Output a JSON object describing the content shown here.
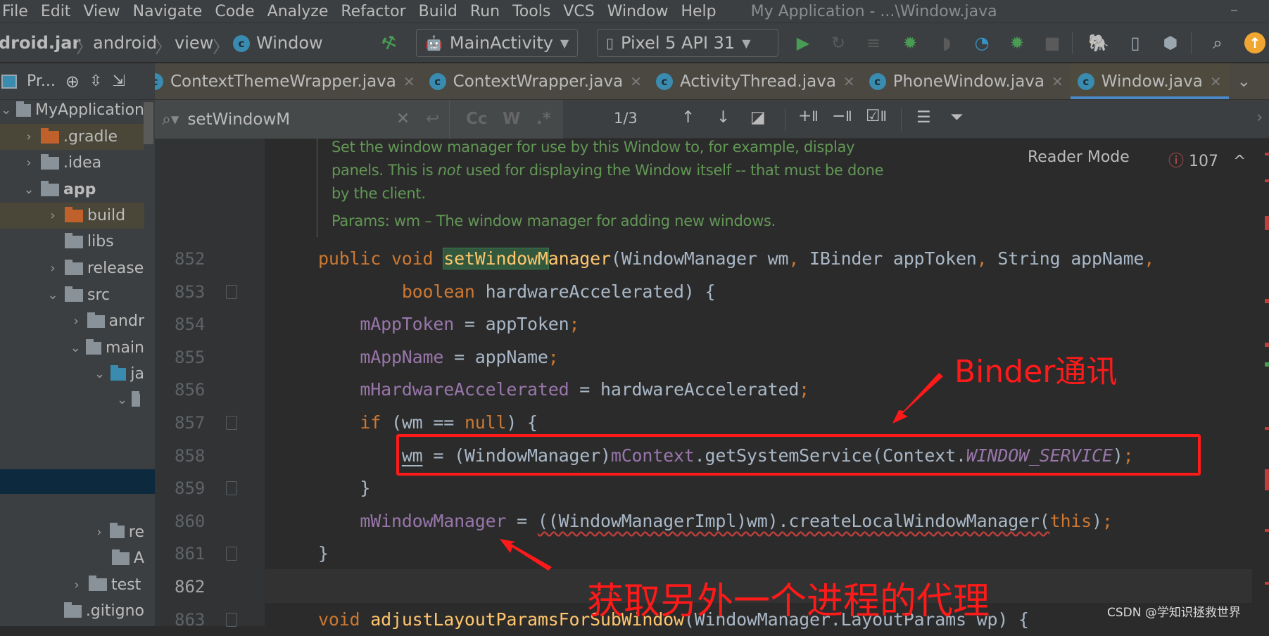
{
  "menu": {
    "items": [
      "File",
      "Edit",
      "View",
      "Navigate",
      "Code",
      "Analyze",
      "Refactor",
      "Build",
      "Run",
      "Tools",
      "VCS",
      "Window",
      "Help"
    ],
    "window_title": "My Application - ...\\Window.java"
  },
  "toolbar": {
    "breadcrumb": [
      "droid.jar",
      "android",
      "view",
      "Window"
    ],
    "run_config": "MainActivity",
    "device": "Pixel 5 API 31",
    "icons": [
      "hammer-icon",
      "run-icon",
      "apply-changes-icon",
      "apply-code-changes-icon",
      "debug-icon",
      "profile-icon",
      "profiler-icon",
      "attach-debugger-icon",
      "stop-icon",
      "gradle-sync-icon",
      "device-manager-icon",
      "sdk-manager-icon",
      "search-icon",
      "update-icon"
    ],
    "accent_green": "#499c54",
    "update_color": "#f0a732"
  },
  "project_panel": {
    "title": "Pr...",
    "tree": [
      {
        "label": "MyApplication",
        "depth": 0,
        "chev": "open",
        "icon": "module"
      },
      {
        "label": ".gradle",
        "depth": 1,
        "chev": "closed",
        "icon": "folder-excluded",
        "highlight": true
      },
      {
        "label": ".idea",
        "depth": 1,
        "chev": "closed",
        "icon": "folder"
      },
      {
        "label": "app",
        "depth": 1,
        "chev": "open",
        "icon": "module",
        "bold": true
      },
      {
        "label": "build",
        "depth": 2,
        "chev": "closed",
        "icon": "folder-excluded",
        "highlight": true
      },
      {
        "label": "libs",
        "depth": 2,
        "chev": "",
        "icon": "folder"
      },
      {
        "label": "release",
        "depth": 2,
        "chev": "closed",
        "icon": "folder"
      },
      {
        "label": "src",
        "depth": 2,
        "chev": "open",
        "icon": "folder"
      },
      {
        "label": "andr",
        "depth": 3,
        "chev": "closed",
        "icon": "folder"
      },
      {
        "label": "main",
        "depth": 3,
        "chev": "open",
        "icon": "folder"
      },
      {
        "label": "ja",
        "depth": 4,
        "chev": "open",
        "icon": "folder-source"
      },
      {
        "label": "",
        "depth": 5,
        "chev": "open",
        "icon": "package"
      },
      {
        "label": "re",
        "depth": 4,
        "chev": "closed",
        "icon": "folder-resources",
        "row": 16
      },
      {
        "label": "A",
        "depth": 4,
        "chev": "",
        "icon": "manifest",
        "row": 17
      },
      {
        "label": "test",
        "depth": 3,
        "chev": "closed",
        "icon": "folder",
        "row": 18
      },
      {
        "label": ".gitigno",
        "depth": 2,
        "chev": "",
        "icon": "gitignore",
        "row": 19
      }
    ]
  },
  "tabs": [
    {
      "label": "ContextThemeWrapper.java",
      "active": false
    },
    {
      "label": "ContextWrapper.java",
      "active": false
    },
    {
      "label": "ActivityThread.java",
      "active": false
    },
    {
      "label": "PhoneWindow.java",
      "active": false
    },
    {
      "label": "Window.java",
      "active": true
    }
  ],
  "find": {
    "query": "setWindowM",
    "match_case": "Cc",
    "words": "W",
    "regex": ".*",
    "count": "1/3"
  },
  "editor": {
    "reader_mode": "Reader Mode",
    "problems_count": "107",
    "doc": [
      "Set the window manager for use by this Window to, for example, display",
      [
        "panels. This is ",
        "not",
        " used for displaying the Window itself -- that must be done"
      ],
      "by the client.",
      "Params: wm – The window manager for adding new windows."
    ],
    "lines": [
      {
        "n": "852",
        "segs": [
          [
            "public void ",
            "k"
          ],
          [
            "setWindowM",
            "m hl"
          ],
          [
            "anager",
            "m"
          ],
          [
            "(WindowManager wm",
            "p"
          ],
          [
            ", ",
            "k"
          ],
          [
            "IBinder appToken",
            "p"
          ],
          [
            ", ",
            "k"
          ],
          [
            "String appName",
            "p"
          ],
          [
            ",",
            "k"
          ]
        ]
      },
      {
        "n": "853",
        "segs": [
          [
            "        ",
            ""
          ],
          [
            "boolean ",
            "k"
          ],
          [
            "hardwareAccelerated) {",
            "p"
          ]
        ]
      },
      {
        "n": "854",
        "segs": [
          [
            "    ",
            ""
          ],
          [
            "mAppToken",
            "f"
          ],
          [
            " = appToken",
            "p"
          ],
          [
            ";",
            "k"
          ]
        ]
      },
      {
        "n": "855",
        "segs": [
          [
            "    ",
            ""
          ],
          [
            "mAppName",
            "f"
          ],
          [
            " = appName",
            "p"
          ],
          [
            ";",
            "k"
          ]
        ]
      },
      {
        "n": "856",
        "segs": [
          [
            "    ",
            ""
          ],
          [
            "mHardwareAccelerated",
            "f"
          ],
          [
            " = hardwareAccelerated",
            "p"
          ],
          [
            ";",
            "k"
          ]
        ]
      },
      {
        "n": "857",
        "segs": [
          [
            "    ",
            ""
          ],
          [
            "if ",
            "k"
          ],
          [
            "(wm == ",
            "p"
          ],
          [
            "null",
            "k"
          ],
          [
            ") {",
            "p"
          ]
        ]
      },
      {
        "n": "858",
        "segs": [
          [
            "        ",
            ""
          ],
          [
            "wm",
            "p uline"
          ],
          [
            " = (WindowManager)",
            "p"
          ],
          [
            "mContext",
            "f"
          ],
          [
            ".getSystemService(Context.",
            "p"
          ],
          [
            "WINDOW_SERVICE",
            "sf"
          ],
          [
            ")",
            "p"
          ],
          [
            ";",
            "k"
          ]
        ]
      },
      {
        "n": "859",
        "segs": [
          [
            "    }",
            "p"
          ]
        ]
      },
      {
        "n": "860",
        "segs": [
          [
            "    ",
            ""
          ],
          [
            "mWindowManager",
            "f"
          ],
          [
            " = ",
            "p"
          ],
          [
            "((WindowManagerImpl)wm).createLocalWindowManager(",
            "p wavy"
          ],
          [
            "this",
            "k"
          ],
          [
            ")",
            "p"
          ],
          [
            ";",
            "k"
          ]
        ]
      },
      {
        "n": "861",
        "segs": [
          [
            "}",
            "p"
          ]
        ]
      },
      {
        "n": "862",
        "segs": []
      },
      {
        "n": "863",
        "segs": [
          [
            "void ",
            "k"
          ],
          [
            "adjustLayoutParamsForSubWindow",
            "m"
          ],
          [
            "(WindowManager.LayoutParams wp) {",
            "p"
          ]
        ]
      }
    ]
  },
  "annotations": {
    "binder": "Binder通讯",
    "proxy": "获取另外一个进程的代理",
    "color": "#ff1a1a"
  },
  "watermark": "CSDN @学知识拯救世界"
}
